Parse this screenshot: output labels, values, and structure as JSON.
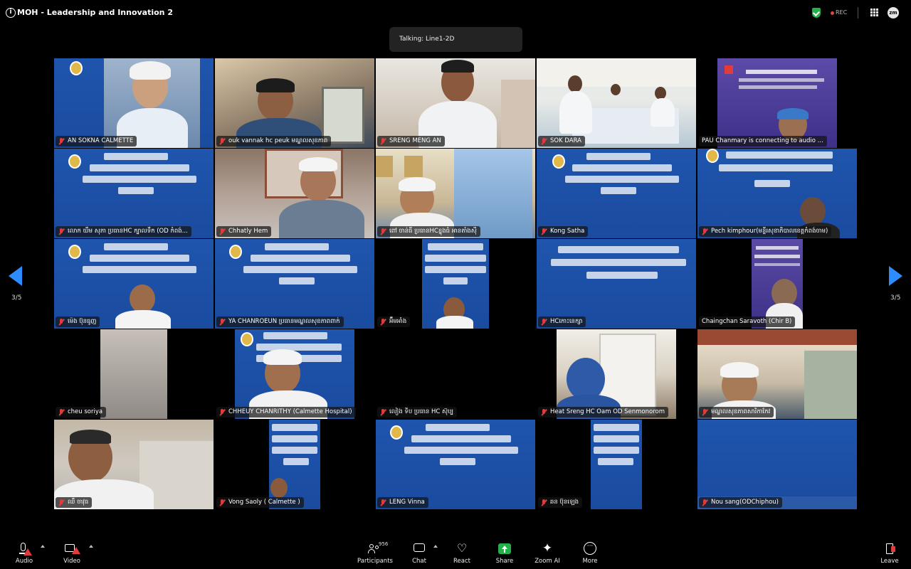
{
  "window": {
    "title": "MOH - Leadership and Innovation 2",
    "rec_label": "REC",
    "app_badge": "zm"
  },
  "talking": {
    "text": "Talking: Line1-2D"
  },
  "nav": {
    "page_left": "3/5",
    "page_right": "3/5"
  },
  "tiles": [
    {
      "name": "AN SOKNA CALMETTE",
      "kind": "camera",
      "muted": true
    },
    {
      "name": "ouk vannak hc peuk មណ្ឌលសុខភាព",
      "kind": "camera",
      "muted": true
    },
    {
      "name": "SRENG MENG AN",
      "kind": "camera",
      "muted": true
    },
    {
      "name": "SOK DARA",
      "kind": "camera",
      "muted": true
    },
    {
      "name": "PAU Chanmary is connecting to audio ...",
      "kind": "camera",
      "muted": false
    },
    {
      "name": "លោក យឹម សុភា ប្រធានHC ក្បាលទឹក (OD កំពង់...",
      "kind": "slide",
      "muted": true
    },
    {
      "name": "Chhatly Hem",
      "kind": "camera",
      "muted": true
    },
    {
      "name": "ពៅ ចាន់ធី ប្រធានHCខ្នុងធំ អានតាំងស៊ី",
      "kind": "camera",
      "muted": true
    },
    {
      "name": "Kong Satha",
      "kind": "slide",
      "muted": true
    },
    {
      "name": "Pech kimphour(មន្ទីរសុខាភិបាលខេត្តកំពង់ចាម)",
      "kind": "slide",
      "muted": true
    },
    {
      "name": "ម៉េង ប៊ុនធូញ",
      "kind": "slide",
      "muted": true
    },
    {
      "name": "YA CHANROEUN ប្រធានមណ្ឌលសុខភាពពាក់",
      "kind": "slide",
      "muted": true
    },
    {
      "name": "អ៊ឹមអាំង",
      "kind": "slide",
      "muted": true
    },
    {
      "name": "HCកោះនេក្សា",
      "kind": "slide",
      "muted": true
    },
    {
      "name": "Chaingchan Saravoth (Chir B)",
      "kind": "slide",
      "muted": false
    },
    {
      "name": "cheu soriya",
      "kind": "camera",
      "muted": true
    },
    {
      "name": "CHHEUY CHANRITHY (Calmette Hospital)",
      "kind": "slide",
      "muted": true
    },
    {
      "name": "លៀង ទិប ប្រធាន HC ស៊ុប្ប",
      "kind": "camera",
      "muted": true
    },
    {
      "name": "Heat Sreng HC Oam OD Senmonorom",
      "kind": "camera",
      "muted": true
    },
    {
      "name": "មណ្ឌលសុខភាពសារិកាកែវ",
      "kind": "camera",
      "muted": true
    },
    {
      "name": "ឈឹ ចាវុធ",
      "kind": "camera",
      "muted": true
    },
    {
      "name": "Vong Saoly ( Calmette )",
      "kind": "slide",
      "muted": true
    },
    {
      "name": "LENG Vinna",
      "kind": "slide",
      "muted": true
    },
    {
      "name": "ឆន ប៊ុនឡេង",
      "kind": "slide",
      "muted": true
    },
    {
      "name": "Nou sang(ODChiphou)",
      "kind": "slide",
      "muted": true
    }
  ],
  "toolbar": {
    "audio": "Audio",
    "video": "Video",
    "participants": "Participants",
    "participants_count": "956",
    "chat": "Chat",
    "react": "React",
    "share": "Share",
    "zoom_ai": "Zoom AI",
    "more": "More",
    "leave": "Leave"
  },
  "colors": {
    "accent": "#2d8cff",
    "muted_red": "#e23b3b",
    "share_green": "#23b04a",
    "slide_blue": "#1d4fa6"
  }
}
